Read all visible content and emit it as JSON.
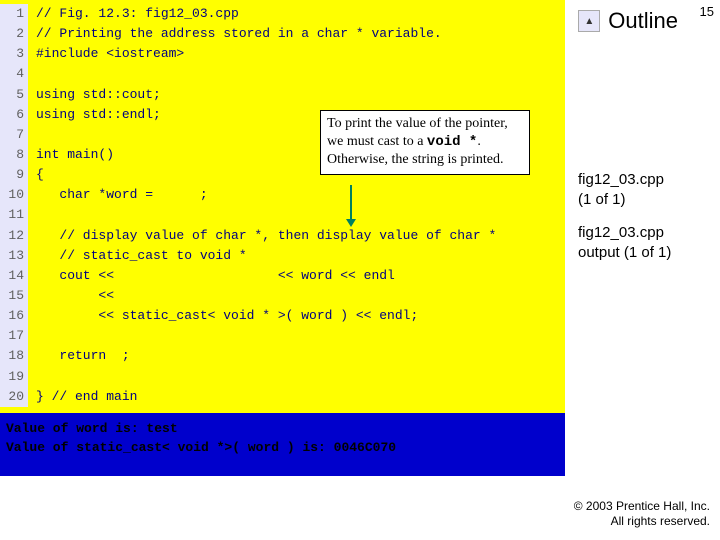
{
  "slide_number": "15",
  "outline": {
    "button_glyph": "▲",
    "label": "Outline"
  },
  "right": {
    "items": [
      {
        "title": "fig12_03.cpp",
        "sub": "(1 of 1)"
      },
      {
        "title": "fig12_03.cpp output (1 of 1)",
        "sub": ""
      }
    ]
  },
  "callout": {
    "pre": "To print the value of the pointer, we must cast to a ",
    "kw": "void *",
    "post": ". Otherwise, the string is printed."
  },
  "code": {
    "lines": [
      "// Fig. 12.3: fig12_03.cpp",
      "// Printing the address stored in a char * variable.",
      "#include <iostream>",
      "",
      "using std::cout;",
      "using std::endl;",
      "",
      "int main()",
      "{",
      "   char *word =      ;",
      "",
      "   // display value of char *, then display value of char *",
      "   // static_cast to void *",
      "   cout <<                     << word << endl",
      "        <<",
      "        << static_cast< void * >( word ) << endl;",
      "",
      "   return  ;",
      "",
      "} // end main"
    ]
  },
  "output": {
    "lines": [
      "Value of word is: test",
      "Value of static_cast< void *>( word ) is: 0046C070"
    ]
  },
  "copyright": {
    "line1": "© 2003 Prentice Hall, Inc.",
    "line2": "All rights reserved."
  }
}
